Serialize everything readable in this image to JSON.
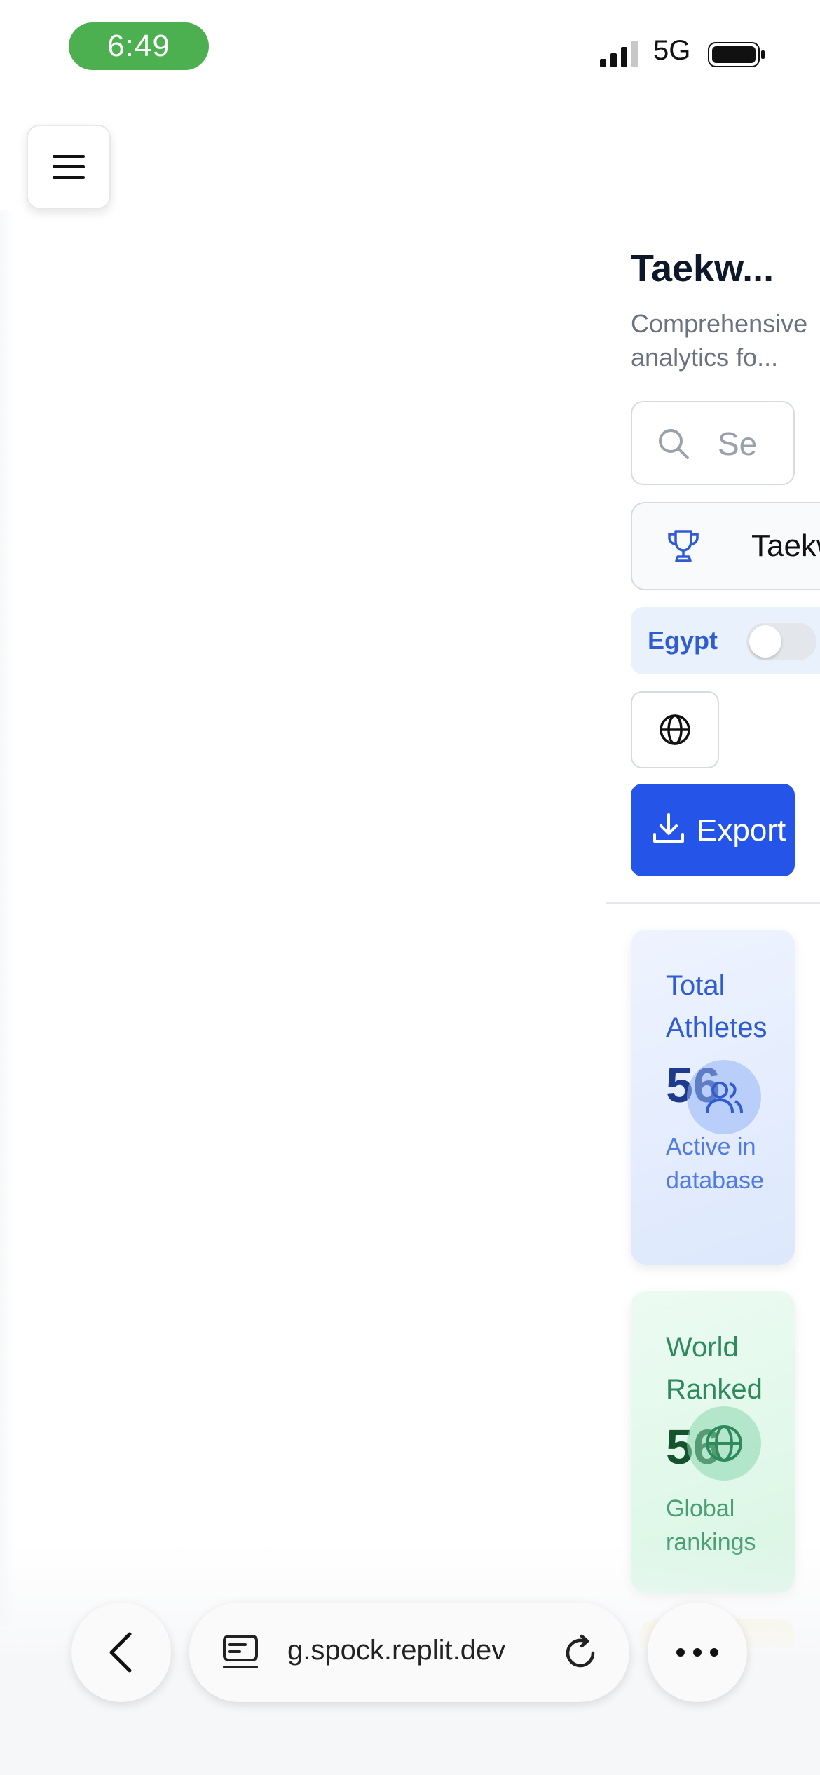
{
  "status_bar": {
    "time": "6:49",
    "network": "5G"
  },
  "header": {
    "title": "Taekw...",
    "subtitle": "Comprehensive analytics fo..."
  },
  "search": {
    "placeholder": "Se"
  },
  "selector": {
    "label": "Taekw"
  },
  "toggle": {
    "label": "Egypt",
    "on": false
  },
  "export_button": {
    "label": "Export"
  },
  "stats": [
    {
      "title": "Total Athletes",
      "value": "56",
      "sub": "Active in database",
      "icon": "users-icon",
      "color": "#2f5bd3"
    },
    {
      "title": "World Ranked",
      "value": "56",
      "sub": "Global rankings",
      "icon": "globe-icon",
      "color": "#2e8a5c"
    }
  ],
  "browser": {
    "url": "g.spock.replit.dev"
  }
}
